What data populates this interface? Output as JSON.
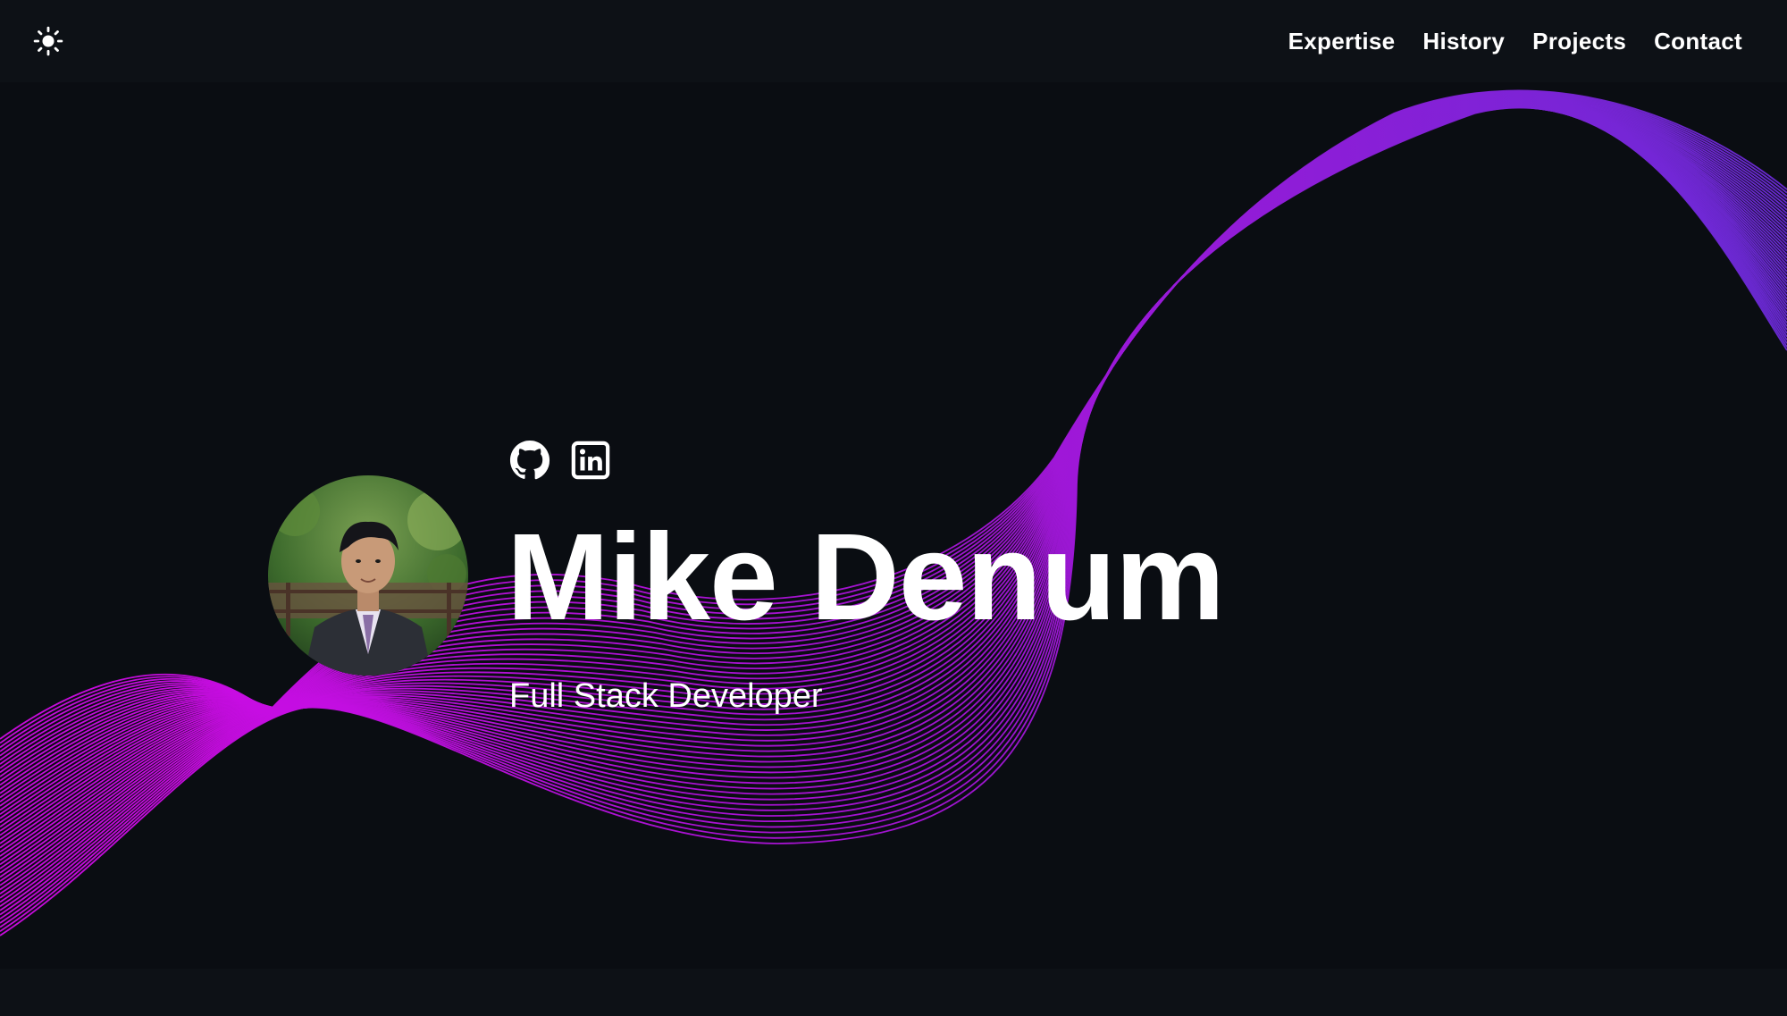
{
  "header": {
    "theme_toggle_icon": "sun-icon",
    "nav": [
      {
        "label": "Expertise"
      },
      {
        "label": "History"
      },
      {
        "label": "Projects"
      },
      {
        "label": "Contact"
      }
    ]
  },
  "hero": {
    "social": [
      {
        "icon": "github-icon"
      },
      {
        "icon": "linkedin-icon"
      }
    ],
    "name": "Mike Denum",
    "role": "Full Stack Developer"
  },
  "colors": {
    "background": "#0a0d12",
    "navbar": "#0d1116",
    "wave_start": "#d20ae6",
    "wave_end": "#6a2ad6",
    "text": "#ffffff"
  }
}
